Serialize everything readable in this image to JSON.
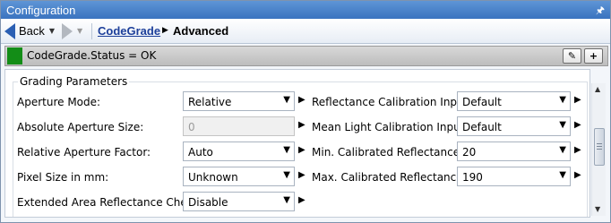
{
  "window": {
    "title": "Configuration",
    "pin_icon": "pin-icon"
  },
  "nav": {
    "back_label": "Back",
    "breadcrumb_link": "CodeGrade",
    "breadcrumb_current": "Advanced"
  },
  "status": {
    "text": "CodeGrade.Status = OK",
    "color": "#138d17",
    "edit_icon": "pencil-icon",
    "add_icon": "plus-icon"
  },
  "group": {
    "title": "Grading Parameters"
  },
  "left_params": [
    {
      "label": "Aperture Mode:",
      "value": "Relative"
    },
    {
      "label": "Absolute Aperture Size:",
      "value": "0"
    },
    {
      "label": "Relative Aperture Factor:",
      "value": "Auto"
    },
    {
      "label": "Pixel Size in mm:",
      "value": "Unknown"
    },
    {
      "label": "Extended Area Reflectance Check:",
      "value": "Disable"
    }
  ],
  "right_params": [
    {
      "label": "Reflectance Calibration Input:",
      "value": "Default"
    },
    {
      "label": "Mean Light Calibration Input:",
      "value": "Default"
    },
    {
      "label": "Min. Calibrated Reflectance:",
      "value": "20"
    },
    {
      "label": "Max. Calibrated Reflectance:",
      "value": "190"
    }
  ]
}
